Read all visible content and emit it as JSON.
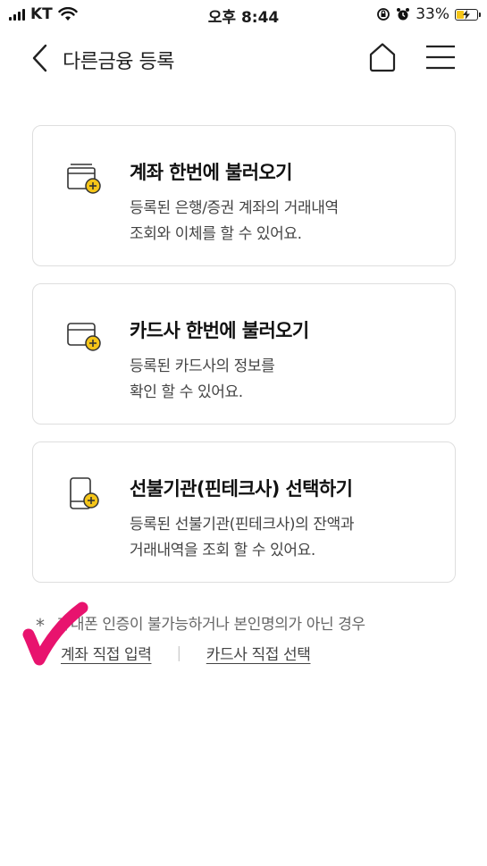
{
  "status_bar": {
    "carrier": "KT",
    "time": "오후 8:44",
    "battery": "33%"
  },
  "header": {
    "title": "다른금융 등록"
  },
  "cards": [
    {
      "title": "계좌 한번에 불러오기",
      "desc_line1": "등록된 은행/증권 계좌의 거래내역",
      "desc_line2": "조회와 이체를 할 수 있어요."
    },
    {
      "title": "카드사 한번에 불러오기",
      "desc_line1": "등록된 카드사의 정보를",
      "desc_line2": "확인 할 수 있어요."
    },
    {
      "title": "선불기관(핀테크사) 선택하기",
      "desc_line1": "등록된 선불기관(핀테크사)의 잔액과",
      "desc_line2": "거래내역을 조회 할 수 있어요."
    }
  ],
  "notice": {
    "star": "*",
    "text": "휴대폰 인증이 불가능하거나 본인명의가 아닌 경우"
  },
  "links": {
    "account_manual": "계좌 직접 입력",
    "separator": "|",
    "card_manual": "카드사 직접 선택"
  },
  "colors": {
    "accent_yellow": "#f5c518",
    "checkmark_pink": "#e8136e",
    "card_border": "#dedede"
  }
}
